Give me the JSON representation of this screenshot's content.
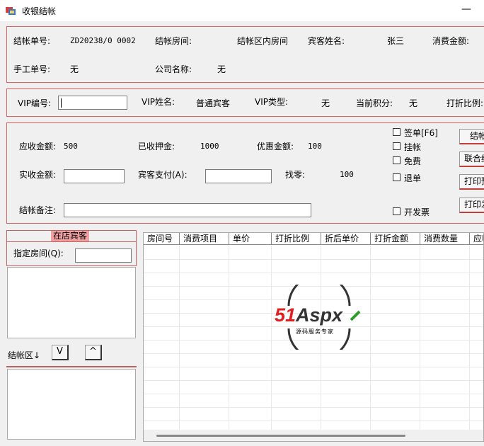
{
  "window": {
    "title": "收银结帐",
    "minimize_glyph": "—"
  },
  "colors": {
    "panel_border": "#e06060",
    "header_pink": "#f0a0a0",
    "logo_red": "#e02020",
    "logo_green": "#2a9d2a"
  },
  "bill": {
    "bill_no_label": "结帐单号:",
    "bill_no_value": "ZD20238/0 0002",
    "room_label": "结帐房间:",
    "room_value": "结帐区内房间",
    "guest_label": "宾客姓名:",
    "guest_value": "张三",
    "amount_label": "消费金额:",
    "manual_label": "手工单号:",
    "manual_value": "无",
    "company_label": "公司名称:",
    "company_value": "无"
  },
  "vip": {
    "no_label": "VIP编号:",
    "no_value": "",
    "name_label": "VIP姓名:",
    "name_value": "普通宾客",
    "type_label": "VIP类型:",
    "type_value": "无",
    "points_label": "当前积分:",
    "points_value": "无",
    "discount_label": "打折比例:"
  },
  "payment": {
    "receivable_label": "应收金额:",
    "receivable_value": "500",
    "deposit_label": "已收押金:",
    "deposit_value": "1000",
    "discount_label": "优惠金额:",
    "discount_value": "100",
    "actual_label": "实收金额:",
    "actual_value": "",
    "guest_pay_label": "宾客支付(A):",
    "guest_pay_value": "",
    "change_label": "找零:",
    "change_value": "100",
    "remark_label": "结帐备注:",
    "remark_value": ""
  },
  "options": {
    "sign_bill": "签单[F6]",
    "hang": "挂帐",
    "free": "免费",
    "refund": "退单",
    "invoice": "开发票"
  },
  "buttons": {
    "checkout": "结帐",
    "joint": "联合结",
    "print1": "打印预",
    "print2": "打印发"
  },
  "guests_panel": {
    "header": "在店宾客",
    "room_label": "指定房间(Q):",
    "room_value": "",
    "checkout_area_label": "结帐区↓",
    "down_glyph": "V",
    "up_glyph": "^"
  },
  "grid": {
    "columns": [
      "房间号",
      "消费项目",
      "单价",
      "打折比例",
      "折后单价",
      "打折金额",
      "消费数量",
      "应收"
    ]
  },
  "watermark": {
    "brand": "51Aspx",
    "brand_51": "51",
    "brand_rest": "Aspx",
    "tagline": "源码服务专家"
  }
}
